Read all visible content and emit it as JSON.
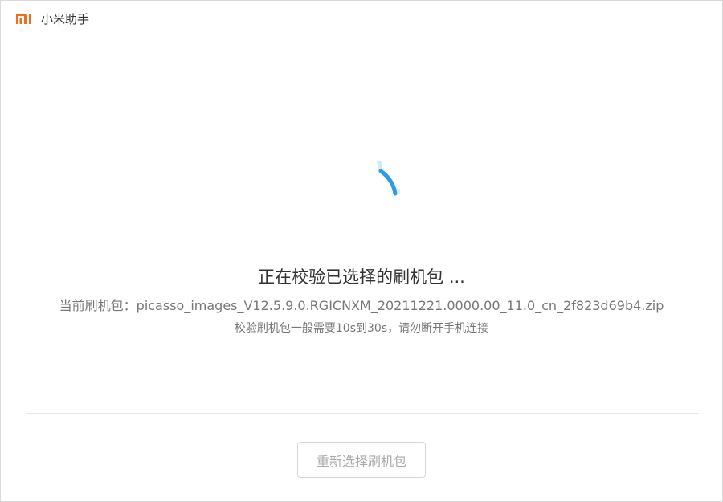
{
  "app": {
    "title": "小米助手",
    "logo_icon": "mi-logo-icon",
    "brand_color": "#f56b1e"
  },
  "status": {
    "icon": "loading-spinner-icon",
    "spinner_color": "#2e9be8",
    "title": "正在校验已选择的刷机包 ...",
    "package_label": "当前刷机包：",
    "package_name": "picasso_images_V12.5.9.0.RGICNXM_20211221.0000.00_11.0_cn_2f823d69b4.zip",
    "hint": "校验刷机包一般需要10s到30s，请勿断开手机连接"
  },
  "actions": {
    "reselect_label": "重新选择刷机包",
    "reselect_enabled": false
  }
}
